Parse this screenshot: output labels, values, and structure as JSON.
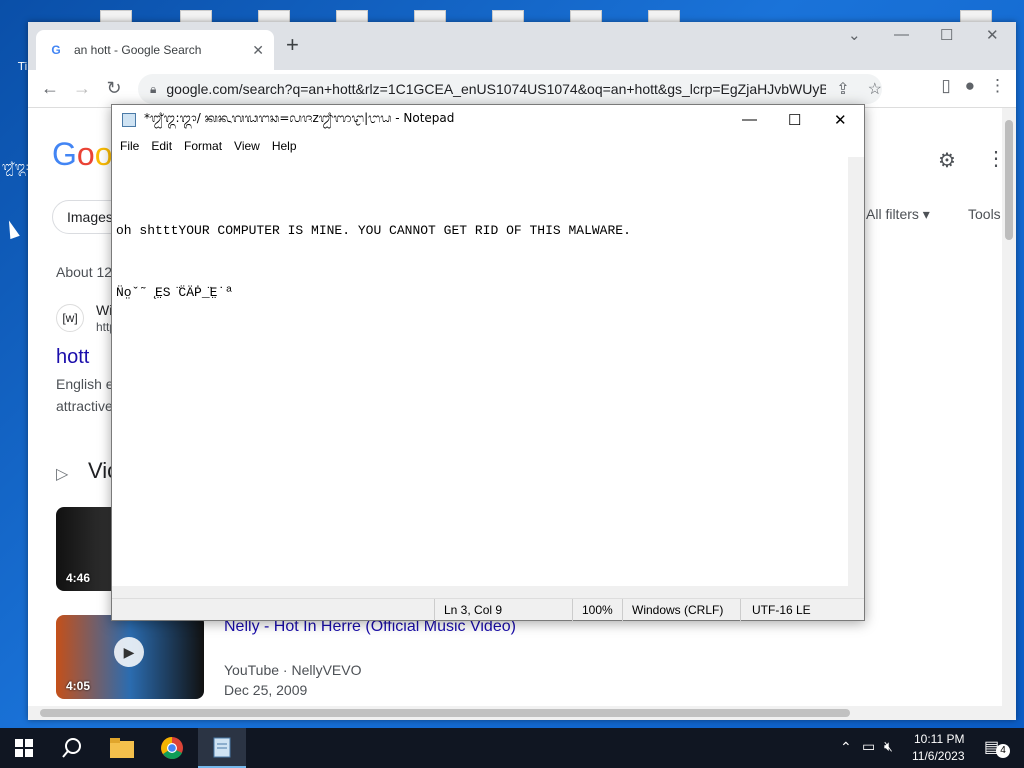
{
  "desktop": {
    "labels": [
      "Ti",
      "ᬐᬑ:"
    ]
  },
  "chrome": {
    "tab_title": "an hott - Google Search",
    "tab_close": "✕",
    "new_tab": "+",
    "url": "google.com/search?q=an+hott&rlz=1C1GCEA_enUS1074US1074&oq=an+hott&gs_lcrp=EgZjaHJvbWUyB...",
    "minimize": "—",
    "maximize": "☐",
    "close": "✕",
    "dropdown": "⌄"
  },
  "google": {
    "logo": [
      "G",
      "o",
      "o"
    ],
    "chip_images": "Images",
    "all_filters": "All filters",
    "tools": "Tools",
    "about": "About 12",
    "wiki_abbrev": "[w]",
    "wiki_site": "Wi",
    "wiki_url": "http",
    "result_title": "hott",
    "result_snippet_1": "English e",
    "result_snippet_2": "attractive",
    "videos_heading": "Vic",
    "video1_duration": "4:46",
    "video2_duration": "4:05",
    "video2_title": "Nelly - Hot In Herre (Official Music Video)",
    "video2_source": "YouTube · NellyVEVO",
    "video2_date": "Dec 25, 2009"
  },
  "notepad": {
    "title": "*ᬐᬑ:ᬒ/ ᬓᬔᬕᬖᬗᬘ=ᬙᬚzᬛᬜᬝ|ᬞᬟ - Notepad",
    "menu": [
      "File",
      "Edit",
      "Format",
      "View",
      "Help"
    ],
    "line1": "oh shtttYOUR COMPUTER IS MINE. YOU CANNOT GET RID OF THIS MALWARE.",
    "line2": "N̈o̤ˇ˜ ̨E̤S ̈C̈ÄṖ_̈E̤˙ª",
    "status_pos": "Ln 3, Col 9",
    "status_zoom": "100%",
    "status_eol": "Windows (CRLF)",
    "status_enc": "UTF-16 LE",
    "minimize": "—",
    "maximize": "☐",
    "close": "✕"
  },
  "taskbar": {
    "time": "10:11 PM",
    "date": "11/6/2023",
    "notifications": "4"
  },
  "colors": {
    "accent": "#1a73e8",
    "link": "#1a0dab",
    "taskbar": "#101622"
  }
}
